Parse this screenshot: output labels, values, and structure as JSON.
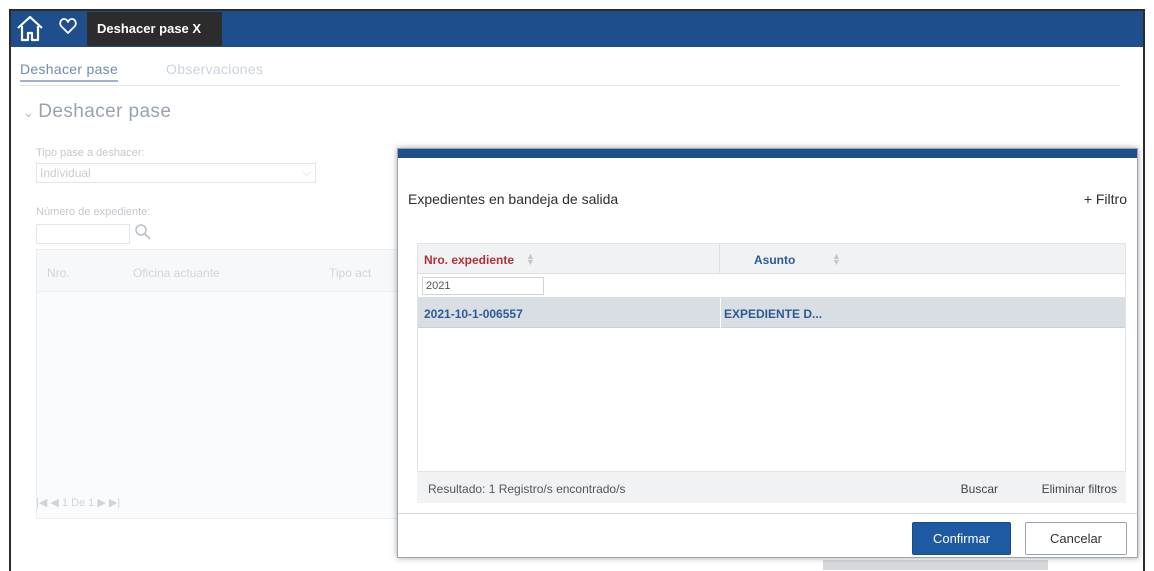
{
  "topbar": {
    "home_icon": "home-icon",
    "favorite_icon": "heart-icon",
    "active_tab": "Deshacer pase X"
  },
  "subtabs": [
    "Deshacer pase",
    "Observaciones"
  ],
  "form": {
    "section_title": "Deshacer pase",
    "tipo_label": "Tipo pase a deshacer:",
    "tipo_value": "Individual",
    "numero_label": "Número de expediente:",
    "table_headers": [
      "Nro.",
      "Oficina actuante",
      "Tipo act"
    ],
    "pager": "|◀ ◀  1  De 1  ▶ ▶|"
  },
  "modal": {
    "title": "Expedientes en bandeja de salida",
    "filter_link": "+ Filtro",
    "columns": [
      "Nro. expediente",
      "Asunto"
    ],
    "filter_value": "2021",
    "rows": [
      {
        "nro": "2021-10-1-006557",
        "asunto": "EXPEDIENTE D..."
      }
    ],
    "result_text": "Resultado: 1 Registro/s encontrado/s",
    "search_label": "Buscar",
    "clear_filters_label": "Eliminar filtros",
    "confirm_label": "Confirmar",
    "cancel_label": "Cancelar"
  },
  "colors": {
    "brand_blue": "#1e4f8c",
    "button_blue": "#1e5aa3",
    "header_red": "#b0313a",
    "link_blue": "#2c5b93"
  }
}
